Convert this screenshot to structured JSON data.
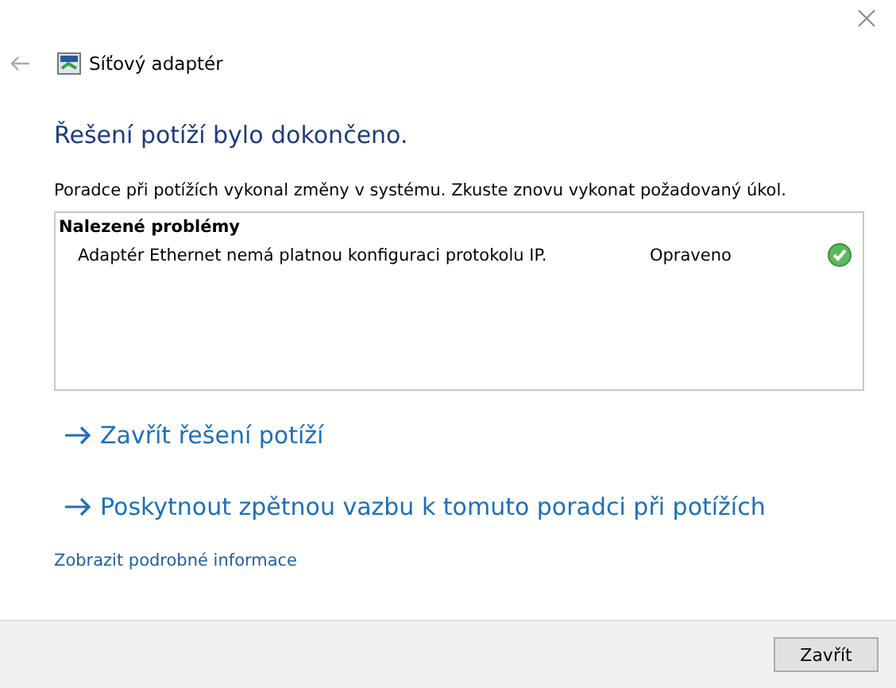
{
  "window": {
    "title": "Síťový adaptér"
  },
  "heading": "Řešení potíží bylo dokončeno.",
  "description": "Poradce při potížích vykonal změny v systému. Zkuste znovu vykonat požadovaný úkol.",
  "problems": {
    "header": "Nalezené problémy",
    "rows": [
      {
        "problem": "Adaptér Ethernet nemá platnou konfiguraci protokolu IP.",
        "status": "Opraveno",
        "fixed": true
      }
    ]
  },
  "actions": [
    "Zavřít řešení potíží",
    "Poskytnout zpětnou vazbu k tomuto poradci při potížích"
  ],
  "details_link": "Zobrazit podrobné informace",
  "buttons": [
    "Zavřít"
  ]
}
